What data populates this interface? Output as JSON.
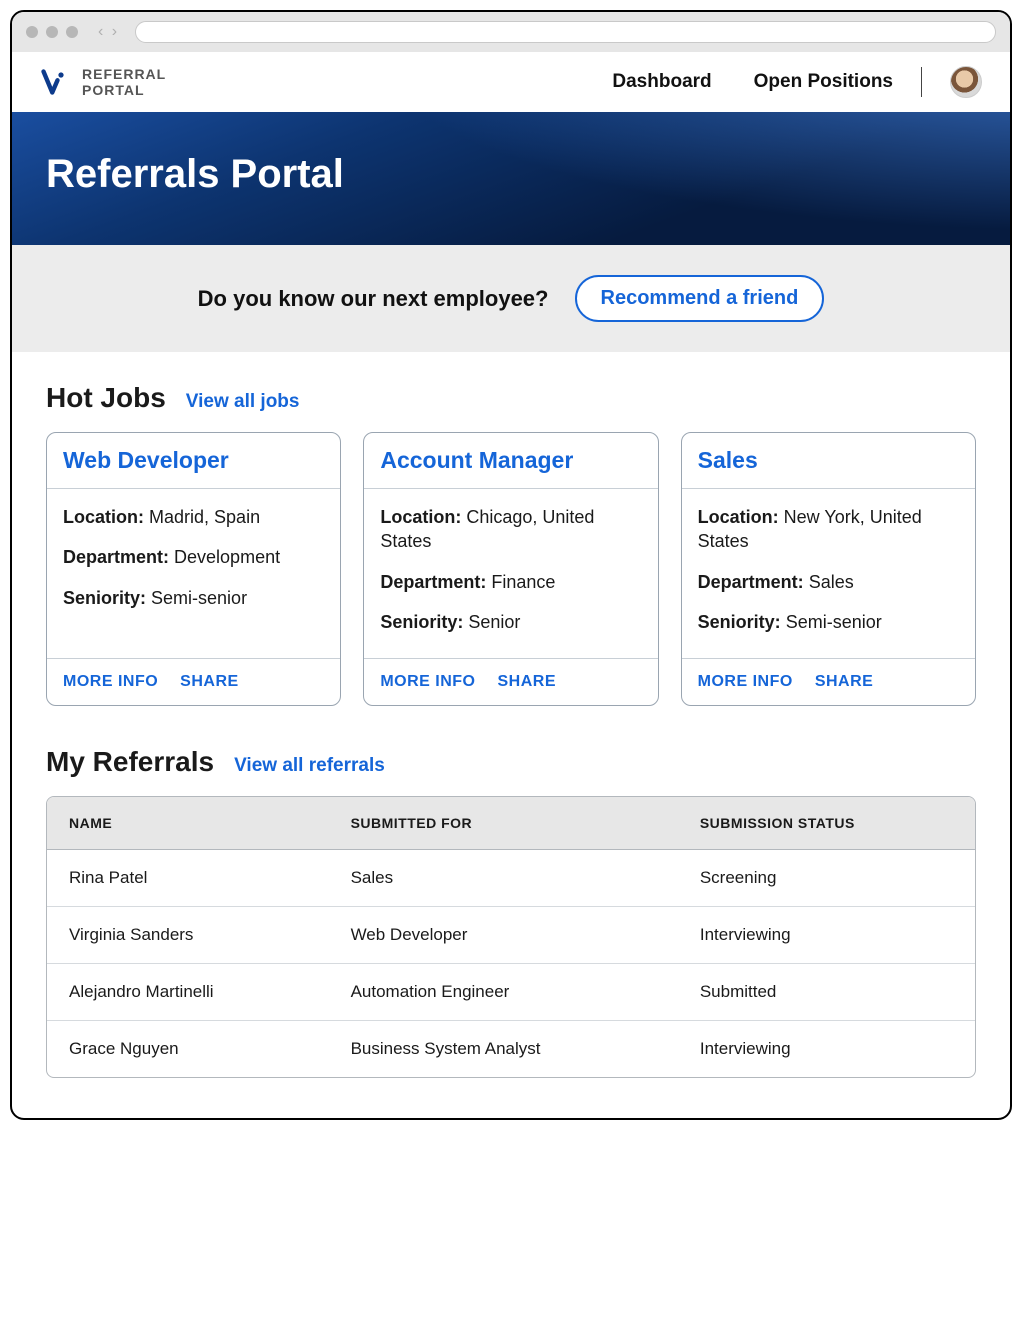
{
  "brand": {
    "line1": "REFERRAL",
    "line2": "PORTAL"
  },
  "nav": {
    "dashboard": "Dashboard",
    "open_positions": "Open Positions"
  },
  "hero": {
    "title": "Referrals Portal"
  },
  "cta": {
    "prompt": "Do you know our next employee?",
    "button": "Recommend a friend"
  },
  "hot_jobs": {
    "title": "Hot Jobs",
    "view_all": "View all jobs",
    "labels": {
      "location": "Location:",
      "department": "Department:",
      "seniority": "Seniority:",
      "more_info": "MORE INFO",
      "share": "SHARE"
    },
    "items": [
      {
        "title": "Web Developer",
        "location": "Madrid, Spain",
        "department": "Development",
        "seniority": "Semi-senior"
      },
      {
        "title": "Account Manager",
        "location": "Chicago, United States",
        "department": "Finance",
        "seniority": "Senior"
      },
      {
        "title": "Sales",
        "location": "New York, United States",
        "department": "Sales",
        "seniority": "Semi-senior"
      }
    ]
  },
  "my_referrals": {
    "title": "My Referrals",
    "view_all": "View all referrals",
    "columns": {
      "name": "NAME",
      "submitted_for": "SUBMITTED FOR",
      "status": "SUBMISSION STATUS"
    },
    "rows": [
      {
        "name": "Rina Patel",
        "submitted_for": "Sales",
        "status": "Screening"
      },
      {
        "name": "Virginia Sanders",
        "submitted_for": "Web Developer",
        "status": "Interviewing"
      },
      {
        "name": "Alejandro Martinelli",
        "submitted_for": "Automation Engineer",
        "status": "Submitted"
      },
      {
        "name": "Grace Nguyen",
        "submitted_for": "Business System Analyst",
        "status": "Interviewing"
      }
    ]
  }
}
